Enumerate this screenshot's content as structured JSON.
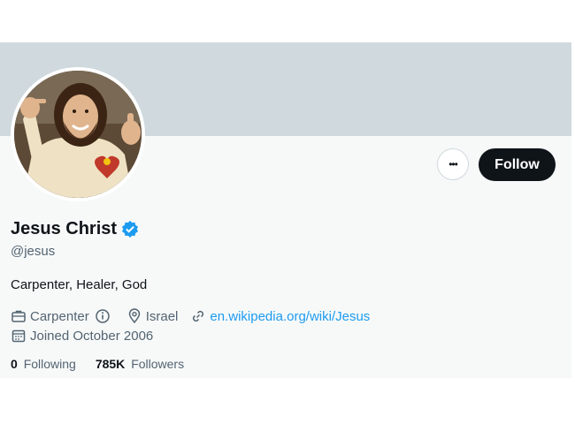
{
  "profile": {
    "display_name": "Jesus Christ",
    "handle": "@jesus",
    "bio": "Carpenter, Healer, God",
    "profession": "Carpenter",
    "location": "Israel",
    "website": "en.wikipedia.org/wiki/Jesus",
    "joined": "Joined October 2006",
    "following_count": "0",
    "following_label": "Following",
    "followers_count": "785K",
    "followers_label": "Followers"
  },
  "actions": {
    "more_label": "•••",
    "follow_label": "Follow"
  },
  "icons": {
    "verified": "verified-badge-icon",
    "profession": "briefcase-icon",
    "info": "info-icon",
    "location": "location-pin-icon",
    "link": "link-icon",
    "calendar": "calendar-icon"
  },
  "colors": {
    "banner": "#cfd9de",
    "follow_button": "#0f1419",
    "link": "#1d9bf0",
    "verified": "#1d9bf0",
    "secondary_text": "#536471"
  }
}
